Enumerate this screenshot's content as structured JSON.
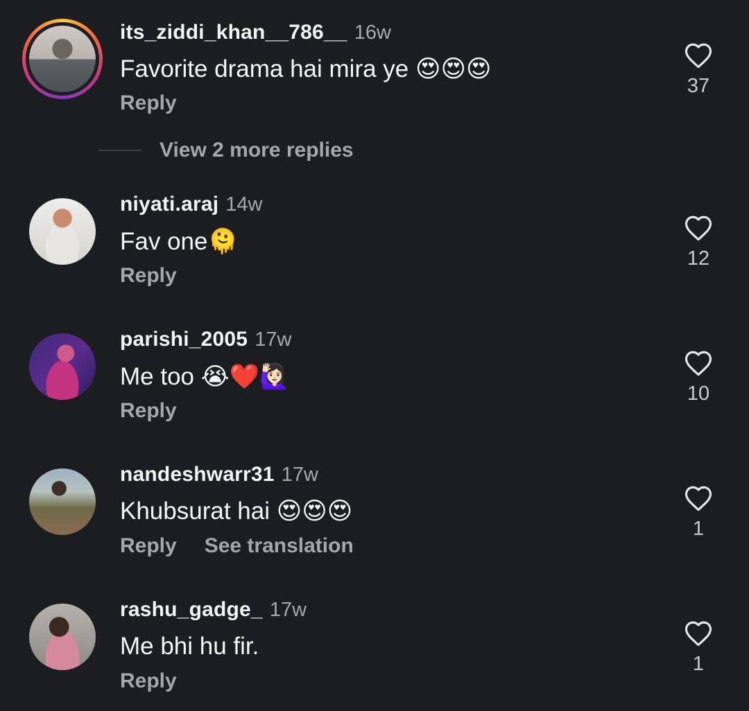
{
  "comments": [
    {
      "username": "its_ziddi_khan__786__",
      "time": "16w",
      "text": "Favorite drama hai mira ye ",
      "emojis": "😍😍😍",
      "reply_label": "Reply",
      "likes": "37",
      "has_story": true
    },
    {
      "username": "niyati.araj",
      "time": "14w",
      "text": "Fav one",
      "emojis": "🫠",
      "reply_label": "Reply",
      "likes": "12"
    },
    {
      "username": "parishi_2005",
      "time": "17w",
      "text": "Me too ",
      "emojis": "😭❤️🙋🏻‍♀️",
      "reply_label": "Reply",
      "likes": "10"
    },
    {
      "username": "nandeshwarr31",
      "time": "17w",
      "text": "Khubsurat hai ",
      "emojis": "😍😍😍",
      "reply_label": "Reply",
      "translate_label": "See translation",
      "likes": "1"
    },
    {
      "username": "rashu_gadge_",
      "time": "17w",
      "text": "Me bhi hu fir.",
      "emojis": "",
      "reply_label": "Reply",
      "likes": "1"
    }
  ],
  "view_more_replies": "View 2 more replies",
  "icons": {
    "like": "heart-outline-icon"
  },
  "colors": {
    "background": "#1c1d21",
    "secondary_text": "#a5a7ab",
    "story_ring": [
      "#f9c440",
      "#f56040",
      "#c13584",
      "#833ab4"
    ]
  }
}
